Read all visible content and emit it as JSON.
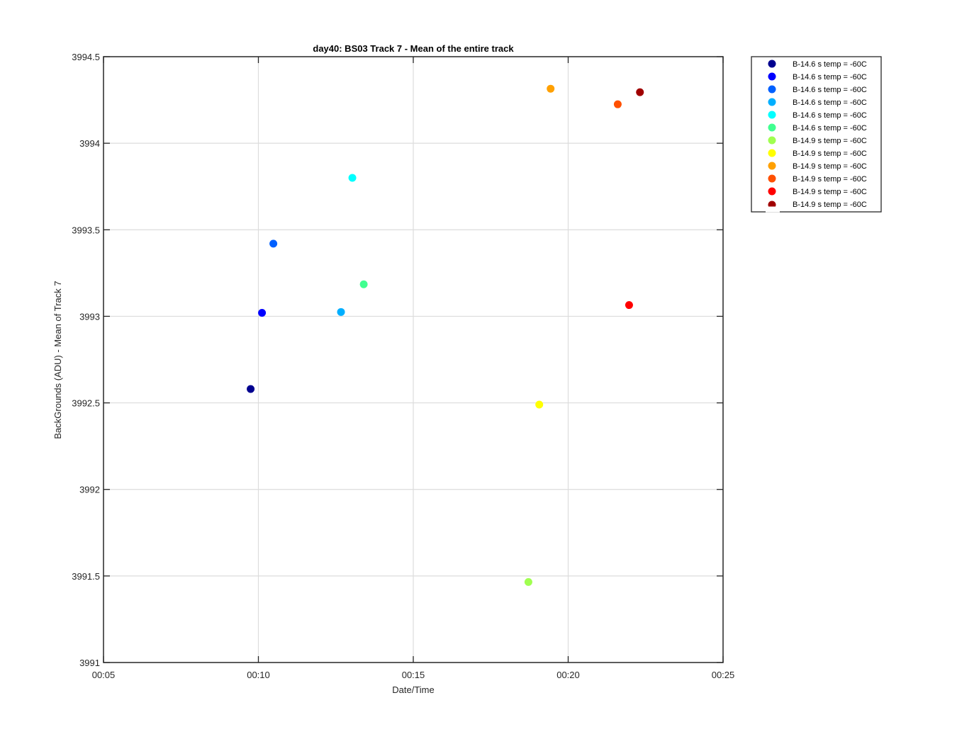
{
  "chart_data": {
    "type": "scatter",
    "title": "day40: BS03  Track 7 - Mean of the entire track",
    "xlabel": "Date/Time",
    "ylabel": "BackGrounds (ADU) - Mean of Track 7",
    "x_unit": "time (HH:MM)",
    "xlim": [
      "00:05",
      "00:25"
    ],
    "ylim": [
      3991,
      3994.5
    ],
    "x_ticks": [
      "00:05",
      "00:10",
      "00:15",
      "00:20",
      "00:25"
    ],
    "y_ticks": [
      "3991",
      "3991.5",
      "3992",
      "3992.5",
      "3993",
      "3993.5",
      "3994",
      "3994.5"
    ],
    "grid": true,
    "legend_position": "outside-right-top",
    "series": [
      {
        "name": "B-14.6 s temp = -60C",
        "color": "#00008f",
        "x": "00:09:45",
        "y": 3992.58
      },
      {
        "name": "B-14.6 s temp = -60C",
        "color": "#0000ff",
        "x": "00:10:07",
        "y": 3993.02
      },
      {
        "name": "B-14.6 s temp = -60C",
        "color": "#0060ff",
        "x": "00:10:29",
        "y": 3993.42
      },
      {
        "name": "B-14.6 s temp = -60C",
        "color": "#00afff",
        "x": "00:12:40",
        "y": 3993.025
      },
      {
        "name": "B-14.6 s temp = -60C",
        "color": "#00ffff",
        "x": "00:13:02",
        "y": 3993.8
      },
      {
        "name": "B-14.6 s temp = -60C",
        "color": "#40ff90",
        "x": "00:13:24",
        "y": 3993.185
      },
      {
        "name": "B-14.9 s temp = -60C",
        "color": "#a0ff50",
        "x": "00:18:43",
        "y": 3991.465
      },
      {
        "name": "B-14.9 s temp = -60C",
        "color": "#ffff00",
        "x": "00:19:04",
        "y": 3992.49
      },
      {
        "name": "B-14.9 s temp = -60C",
        "color": "#ffa000",
        "x": "00:19:26",
        "y": 3994.315
      },
      {
        "name": "B-14.9 s temp = -60C",
        "color": "#ff5000",
        "x": "00:21:36",
        "y": 3994.225
      },
      {
        "name": "B-14.9 s temp = -60C",
        "color": "#ff0000",
        "x": "00:21:58",
        "y": 3993.065
      },
      {
        "name": "B-14.9 s temp = -60C",
        "color": "#a00000",
        "x": "00:22:19",
        "y": 3994.295
      }
    ]
  }
}
